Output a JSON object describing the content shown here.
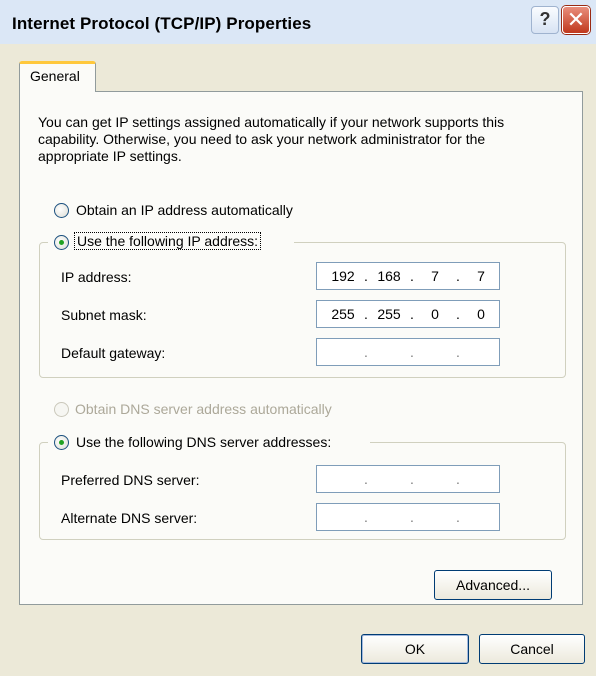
{
  "window": {
    "title": "Internet Protocol (TCP/IP) Properties",
    "help_glyph": "?",
    "close_glyph": "✕",
    "titlebar_color": "#dbe7f6",
    "close_color": "#c0381d"
  },
  "tabs": [
    {
      "label": "General",
      "selected": true
    }
  ],
  "description": "You can get IP settings assigned automatically if your network supports this capability. Otherwise, you need to ask your network administrator for the appropriate IP settings.",
  "ip": {
    "auto_label": "Obtain an IP address automatically",
    "manual_label": "Use the following IP address:",
    "selected": "manual",
    "fields": [
      {
        "label": "IP address:",
        "octets": [
          "192",
          "168",
          "7",
          "7"
        ]
      },
      {
        "label": "Subnet mask:",
        "octets": [
          "255",
          "255",
          "0",
          "0"
        ]
      },
      {
        "label": "Default gateway:",
        "octets": [
          "",
          "",
          "",
          ""
        ]
      }
    ]
  },
  "dns": {
    "auto_label": "Obtain DNS server address automatically",
    "auto_enabled": false,
    "manual_label": "Use the following DNS server addresses:",
    "selected": "manual",
    "fields": [
      {
        "label": "Preferred DNS server:",
        "octets": [
          "",
          "",
          "",
          ""
        ]
      },
      {
        "label": "Alternate DNS server:",
        "octets": [
          "",
          "",
          "",
          ""
        ]
      }
    ]
  },
  "buttons": {
    "advanced": "Advanced...",
    "ok": "OK",
    "cancel": "Cancel"
  },
  "octet_separator": "."
}
